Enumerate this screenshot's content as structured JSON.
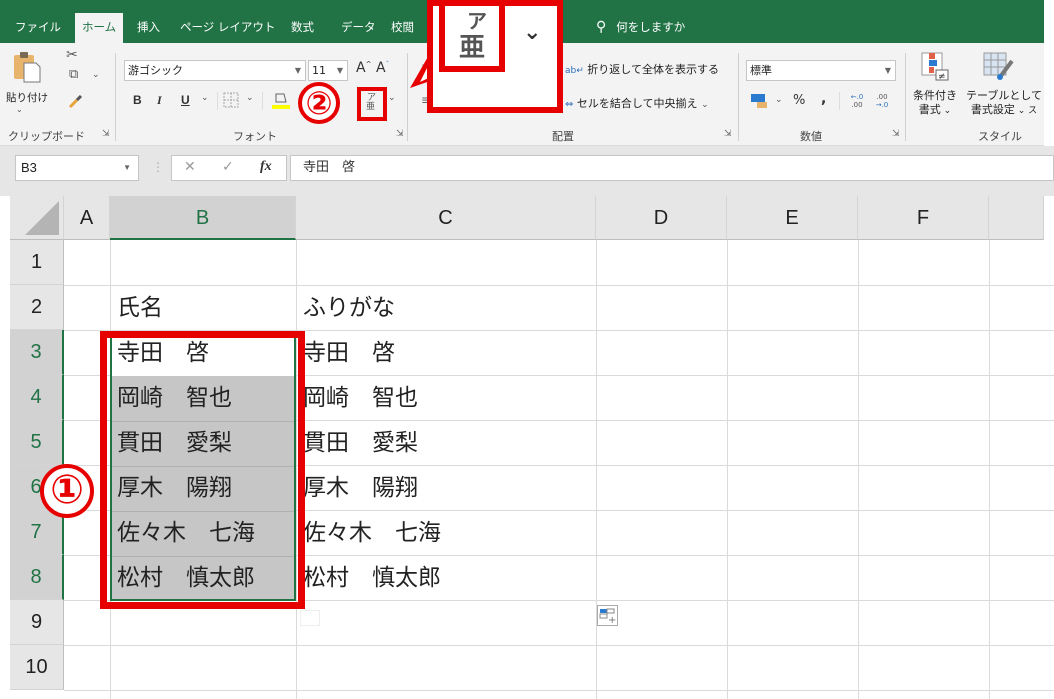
{
  "ribbon_tabs": [
    "ファイル",
    "ホーム",
    "挿入",
    "ページ レイアウト",
    "数式",
    "データ",
    "校閲"
  ],
  "active_tab": "ホーム",
  "tell_me": {
    "icon": "lightbulb-icon",
    "label": "何をしますか"
  },
  "clipboard": {
    "paste_label": "貼り付け",
    "group_label": "クリップボード"
  },
  "font": {
    "name": "游ゴシック",
    "size": "11",
    "bold": "B",
    "italic": "I",
    "underline": "U",
    "grow": "A",
    "shrink": "A",
    "group_label": "フォント"
  },
  "alignment": {
    "wrap_text": "折り返して全体を表示する",
    "merge_center": "セルを結合して中央揃え",
    "group_label": "配置"
  },
  "number": {
    "format": "標準",
    "percent": "%",
    "comma": ",",
    "inc_decimal": "←.0 .00",
    "dec_decimal": ".00 →.0",
    "group_label": "数値"
  },
  "styles": {
    "conditional_line1": "条件付き",
    "conditional_line2": "書式",
    "table_line1": "テーブルとして",
    "table_line2": "書式設定",
    "group_label": "スタイル"
  },
  "formula_bar": {
    "name_box": "B3",
    "cancel": "✕",
    "enter": "✓",
    "fx": "fx",
    "content": "寺田　啓"
  },
  "columns": [
    "A",
    "B",
    "C",
    "D",
    "E",
    "F"
  ],
  "selected_column": "B",
  "rows": [
    "1",
    "2",
    "3",
    "4",
    "5",
    "6",
    "7",
    "8",
    "9",
    "10"
  ],
  "selected_rows": [
    "3",
    "4",
    "5",
    "6",
    "7",
    "8"
  ],
  "cells": {
    "B2": "氏名",
    "C2": "ふりがな",
    "B3": "寺田　啓",
    "C3": "寺田　啓",
    "B4": "岡崎　智也",
    "C4": "岡崎　智也",
    "B5": "貫田　愛梨",
    "C5": "貫田　愛梨",
    "B6": "厚木　陽翔",
    "C6": "厚木　陽翔",
    "B7": "佐々木　七海",
    "C7": "佐々木　七海",
    "B8": "松村　慎太郎",
    "C8": "松村　慎太郎"
  },
  "annotations": {
    "step1": "①",
    "step2": "②",
    "callout_icon": "furigana-icon",
    "accent_color": "#e60000"
  },
  "colors": {
    "excel_green": "#217346",
    "selection_gray": "#c6c6c6"
  }
}
